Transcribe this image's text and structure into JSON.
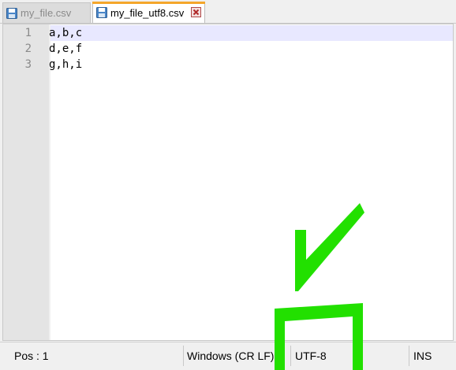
{
  "tabs": [
    {
      "label": "my_file.csv",
      "active": false
    },
    {
      "label": "my_file_utf8.csv",
      "active": true
    }
  ],
  "editor": {
    "lines": [
      {
        "number": "1",
        "text": "a,b,c"
      },
      {
        "number": "2",
        "text": "d,e,f"
      },
      {
        "number": "3",
        "text": "g,h,i"
      }
    ]
  },
  "status": {
    "position": "Pos : 1",
    "eol": "Windows (CR LF)",
    "encoding": "UTF-8",
    "mode": "INS"
  },
  "colors": {
    "active_tab_accent": "#f4a62a",
    "current_line": "#e8e8ff",
    "annotation": "#22e000"
  }
}
